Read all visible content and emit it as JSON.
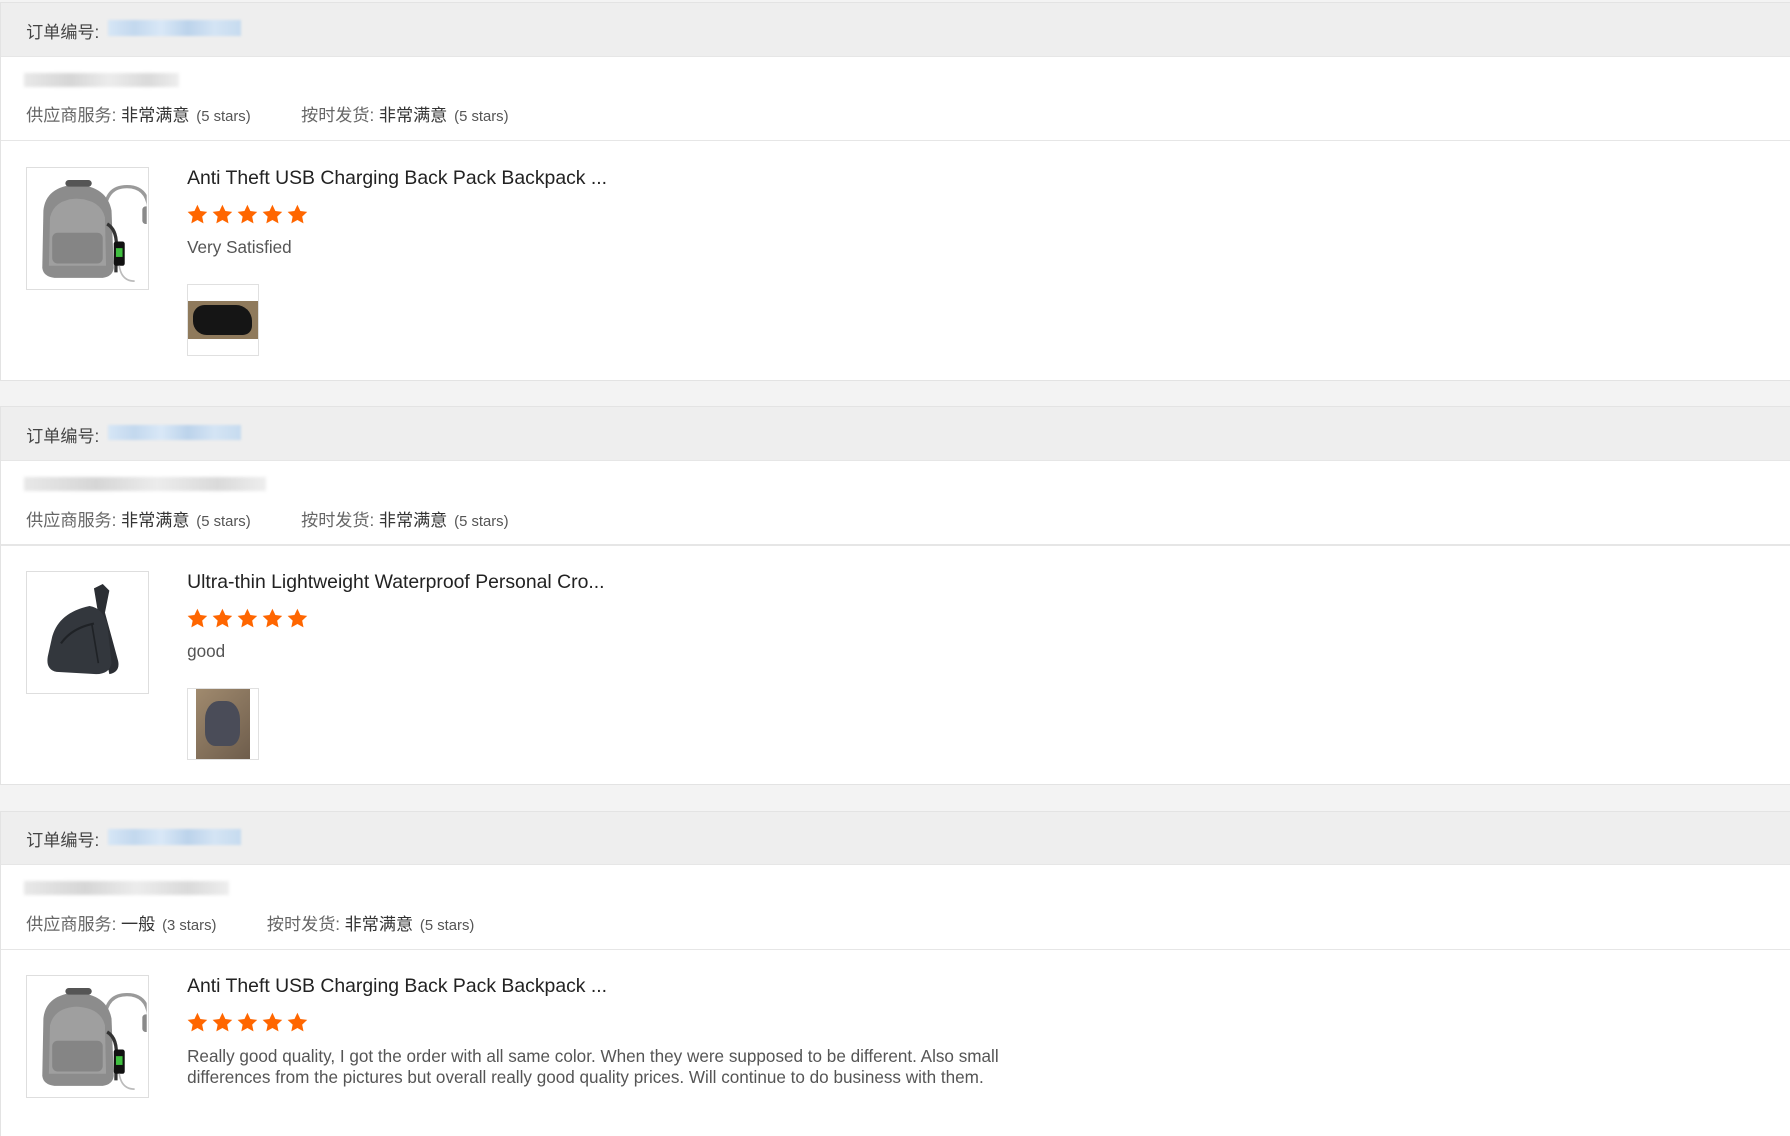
{
  "orders": [
    {
      "order_no_label": "订单编号:",
      "supplier_service": {
        "label": "供应商服务:",
        "value": "非常满意",
        "stars": "(5 stars)"
      },
      "on_time_shipping": {
        "label": "按时发货:",
        "value": "非常满意",
        "stars": "(5 stars)"
      },
      "product": {
        "title": "Anti Theft USB Charging Back Pack Backpack ...",
        "rating": 5,
        "review": "Very Satisfied",
        "image_icon": "backpack-icon",
        "has_photo": true
      }
    },
    {
      "order_no_label": "订单编号:",
      "supplier_service": {
        "label": "供应商服务:",
        "value": "非常满意",
        "stars": "(5 stars)"
      },
      "on_time_shipping": {
        "label": "按时发货:",
        "value": "非常满意",
        "stars": "(5 stars)"
      },
      "product": {
        "title": "Ultra-thin Lightweight Waterproof Personal Cro...",
        "rating": 5,
        "review": "good",
        "image_icon": "sling-bag-icon",
        "has_photo": true
      }
    },
    {
      "order_no_label": "订单编号:",
      "supplier_service": {
        "label": "供应商服务:",
        "value": "一般",
        "stars": "(3 stars)"
      },
      "on_time_shipping": {
        "label": "按时发货:",
        "value": "非常满意",
        "stars": "(5 stars)"
      },
      "product": {
        "title": "Anti Theft USB Charging Back Pack Backpack ...",
        "rating": 5,
        "review": "Really good quality, I got the order with all same color. When they were supposed to be different. Also small differences from the pictures but overall really good quality prices. Will continue to do business with them.",
        "image_icon": "backpack-icon",
        "has_photo": false
      }
    }
  ],
  "colors": {
    "star": "#ff6600",
    "header_bg": "#eeeeee",
    "border": "#e3e3e3"
  }
}
